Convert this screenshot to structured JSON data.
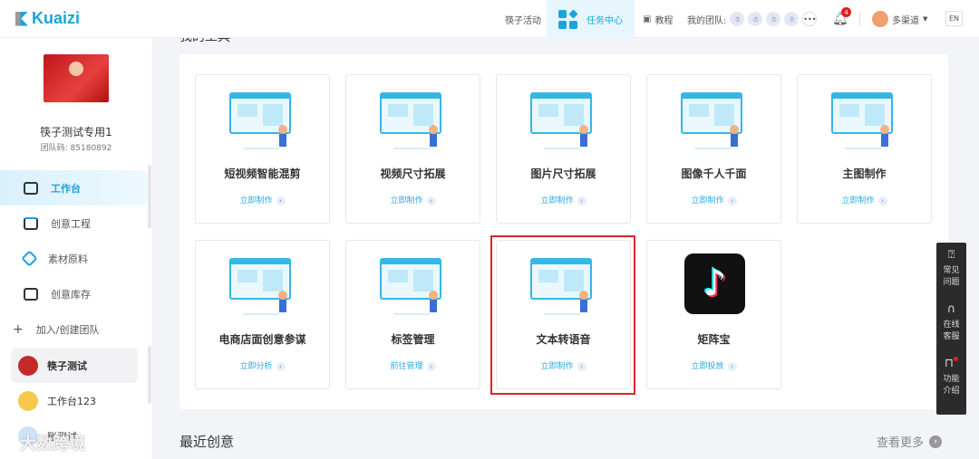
{
  "header": {
    "brand": "Kuaizi",
    "activity": "筷子活动",
    "task_center": "任务中心",
    "tutorial": "教程",
    "my_team": "我的团队:",
    "more": "•••",
    "notifications": "4",
    "user": "多渠道",
    "lang": "EN"
  },
  "sidebar": {
    "name": "筷子测试专用1",
    "team_code": "团队码: 85180892",
    "nav": [
      {
        "label": "工作台",
        "icon": "monitor-icon"
      },
      {
        "label": "创意工程",
        "icon": "inbox-icon"
      },
      {
        "label": "素材原料",
        "icon": "diamond-icon"
      },
      {
        "label": "创意库存",
        "icon": "play-library-icon"
      }
    ],
    "join": "加入/创建团队",
    "teams": [
      {
        "label": "筷子测试"
      },
      {
        "label": "工作台123"
      },
      {
        "label": "账测试"
      }
    ]
  },
  "main": {
    "section_title": "我的工具",
    "tools": [
      {
        "title": "短视频智能混剪",
        "action": "立即制作"
      },
      {
        "title": "视频尺寸拓展",
        "action": "立即制作"
      },
      {
        "title": "图片尺寸拓展",
        "action": "立即制作"
      },
      {
        "title": "图像千人千面",
        "action": "立即制作"
      },
      {
        "title": "主图制作",
        "action": "立即制作"
      },
      {
        "title": "电商店面创意参谋",
        "action": "立即分析"
      },
      {
        "title": "标签管理",
        "action": "前往管理"
      },
      {
        "title": "文本转语音",
        "action": "立即制作"
      },
      {
        "title": "矩阵宝",
        "action": "立即投放"
      }
    ],
    "recent": "最近创意",
    "see_more": "查看更多"
  },
  "float": {
    "faq": "常见问题",
    "service": "在线客服",
    "intro": "功能介绍"
  },
  "watermark": "大数跨境",
  "colors": {
    "accent": "#1aa3dc",
    "highlight": "#d7262b"
  }
}
